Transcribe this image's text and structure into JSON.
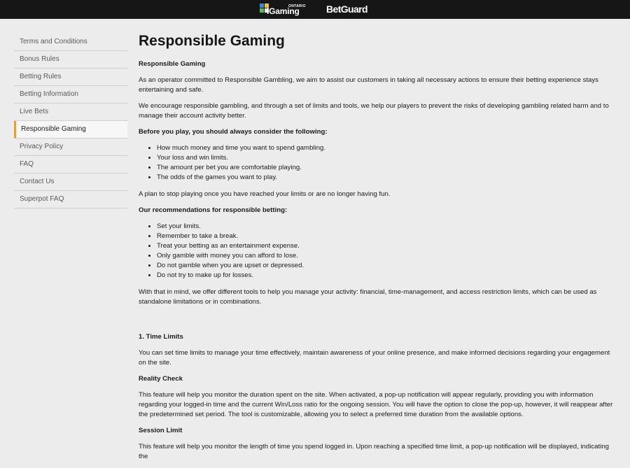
{
  "header": {
    "igaming_logo_text": "iGaming",
    "igaming_logo_sub": "ONTARIO",
    "brand_logo": "BetGuard"
  },
  "sidebar": {
    "items": [
      {
        "label": "Terms and Conditions"
      },
      {
        "label": "Bonus Rules"
      },
      {
        "label": "Betting Rules"
      },
      {
        "label": "Betting Information"
      },
      {
        "label": "Live Bets"
      },
      {
        "label": "Responsible Gaming"
      },
      {
        "label": "Privacy Policy"
      },
      {
        "label": "FAQ"
      },
      {
        "label": "Contact Us"
      },
      {
        "label": "Superpot FAQ"
      }
    ],
    "active_index": 5
  },
  "main": {
    "title": "Responsible Gaming",
    "subtitle": "Responsible Gaming",
    "intro_1": "As an operator committed to Responsible Gambling, we aim to assist our customers in taking all necessary actions to ensure their betting experience stays entertaining and safe.",
    "intro_2": "We encourage responsible gambling, and through a set of limits and tools, we help our players to prevent the risks of developing gambling related harm and to manage their account activity better.",
    "before_heading": "Before you play, you should always consider the following:",
    "before_list": [
      "How much money and time you want to spend gambling.",
      "Your loss and win limits.",
      "The amount per bet you are comfortable playing.",
      "The odds of the games you want to play."
    ],
    "plan_text": "A plan to stop playing once you have reached your limits or are no longer having fun.",
    "recommend_heading": "Our recommendations for responsible betting:",
    "recommend_list": [
      "Set your limits.",
      "Remember to take a break.",
      "Treat your betting as an entertainment expense.",
      "Only gamble with money you can afford to lose.",
      "Do not gamble when you are upset or depressed.",
      "Do not try to make up for losses."
    ],
    "tools_text": "With that in mind, we offer  different tools to help you manage your activity: financial, time-management, and access restriction limits, which can be used as standalone limitations or in combinations.",
    "time_limits_heading": "1. Time Limits",
    "time_limits_text": "You can set time limits to  manage your time effectively, maintain awareness of your online presence, and make informed decisions regarding your engagement on the site.",
    "reality_heading": "Reality Check",
    "reality_text": "This feature will help you monitor the duration spent on the site. When activated, a pop-up notification will appear regularly, providing you with information regarding your logged-in time and the current Win/Loss ratio for the ongoing session. You will have the option to close the pop-up, however, it will reappear after the predetermined set period. The tool is customizable, allowing you to select a preferred time duration from the available options.",
    "session_heading": "Session Limit",
    "session_text": "This feature will help you monitor the length of time you spend logged in. Upon reaching a specified time limit, a pop-up notification will be displayed, indicating the"
  }
}
